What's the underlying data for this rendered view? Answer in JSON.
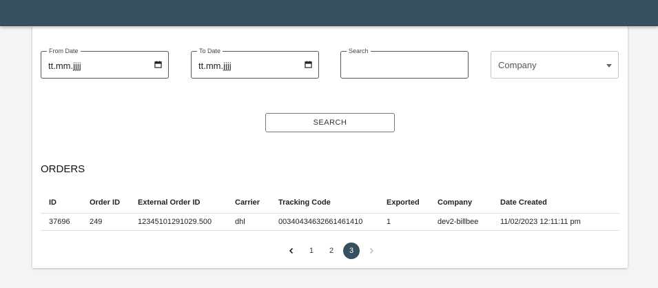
{
  "filters": {
    "from_date": {
      "label": "From Date",
      "value": "tt.mm.jjjj"
    },
    "to_date": {
      "label": "To Date",
      "value": "tt.mm.jjjj"
    },
    "search": {
      "label": "Search",
      "value": ""
    },
    "company": {
      "placeholder": "Company"
    }
  },
  "search_button": "SEARCH",
  "orders": {
    "title": "ORDERS",
    "columns": [
      "ID",
      "Order ID",
      "External Order ID",
      "Carrier",
      "Tracking Code",
      "Exported",
      "Company",
      "Date Created"
    ],
    "rows": [
      [
        "37696",
        "249",
        "12345101291029.500",
        "dhl",
        "00340434632661461410",
        "1",
        "dev2-billbee",
        "11/02/2023 12:11:11 pm"
      ]
    ]
  },
  "pagination": {
    "prev": "‹",
    "pages": [
      "1",
      "2",
      "3"
    ],
    "current": "3",
    "next": "›"
  },
  "colors": {
    "topbar": "#37505f",
    "active_page": "#37505f"
  }
}
